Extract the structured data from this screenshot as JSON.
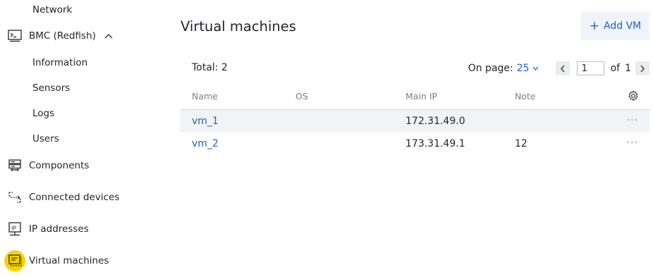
{
  "sidebar": {
    "items": [
      {
        "label": "Network"
      },
      {
        "label": "BMC (Redfish)",
        "icon": "terminal-icon"
      },
      {
        "label": "Information"
      },
      {
        "label": "Sensors"
      },
      {
        "label": "Logs"
      },
      {
        "label": "Users"
      },
      {
        "label": "Components",
        "icon": "server-icon"
      },
      {
        "label": "Connected devices",
        "icon": "connected-devices-icon"
      },
      {
        "label": "IP addresses",
        "icon": "ip-icon"
      },
      {
        "label": "Virtual machines",
        "icon": "vm-icon",
        "active": true
      }
    ]
  },
  "main": {
    "title": "Virtual machines",
    "add_button": "Add VM",
    "total_label": "Total: 2",
    "pager": {
      "on_page_label": "On page:",
      "on_page_value": "25",
      "current_page": "1",
      "of_label": "of",
      "total_pages": "1"
    },
    "table": {
      "headers": [
        "Name",
        "OS",
        "Main IP",
        "Note"
      ],
      "rows": [
        {
          "name": "vm_1",
          "os": "",
          "main_ip": "172.31.49.0",
          "note": ""
        },
        {
          "name": "vm_2",
          "os": "",
          "main_ip": "173.31.49.1",
          "note": "12"
        }
      ]
    }
  },
  "colors": {
    "accent": "#1a63c7",
    "active_highlight": "#f7d400",
    "add_button_bg": "#f0f4fa",
    "row_stripe": "#f2f3f5"
  }
}
